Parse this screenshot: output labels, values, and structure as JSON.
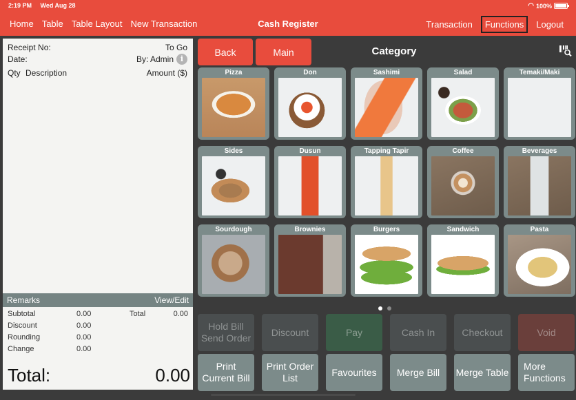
{
  "status_bar": {
    "time": "2:19 PM",
    "date": "Wed Aug 28",
    "battery": "100%",
    "battery_level": 1.0
  },
  "nav": {
    "left": [
      "Home",
      "Table",
      "Table Layout",
      "New Transaction"
    ],
    "title": "Cash Register",
    "right": [
      "Transaction",
      "Functions",
      "Logout"
    ],
    "active": "Functions"
  },
  "receipt": {
    "receipt_no_label": "Receipt No:",
    "order_type": "To Go",
    "date_label": "Date:",
    "by_label": "By: Admin",
    "info_icon": "i",
    "qty_label": "Qty",
    "desc_label": "Description",
    "amount_label": "Amount ($)",
    "remarks_label": "Remarks",
    "view_edit_label": "View/Edit",
    "subtotal_label": "Subtotal",
    "subtotal": "0.00",
    "total_label": "Total",
    "total": "0.00",
    "discount_label": "Discount",
    "discount": "0.00",
    "rounding_label": "Rounding",
    "rounding": "0.00",
    "change_label": "Change",
    "change": "0.00",
    "grand_total_label": "Total:",
    "grand_total": "0.00"
  },
  "category_header": {
    "back": "Back",
    "main": "Main",
    "title": "Category"
  },
  "categories": [
    {
      "name": "Pizza",
      "image": "pizza-photo"
    },
    {
      "name": "Don",
      "image": "don-bowl-photo"
    },
    {
      "name": "Sashimi",
      "image": "sashimi-photo"
    },
    {
      "name": "Salad",
      "image": "salad-photo"
    },
    {
      "name": "Temaki/Maki",
      "image": "temaki-photo"
    },
    {
      "name": "Sides",
      "image": "sides-photo"
    },
    {
      "name": "Dusun",
      "image": "dusun-bottle-photo"
    },
    {
      "name": "Tapping Tapir",
      "image": "tapping-tapir-bottle-photo"
    },
    {
      "name": "Coffee",
      "image": "coffee-photo"
    },
    {
      "name": "Beverages",
      "image": "beverage-photo"
    },
    {
      "name": "Sourdough",
      "image": "sourdough-photo"
    },
    {
      "name": "Brownies",
      "image": "brownies-photo"
    },
    {
      "name": "Burgers",
      "image": "burger-photo"
    },
    {
      "name": "Sandwich",
      "image": "sandwich-photo"
    },
    {
      "name": "Pasta",
      "image": "pasta-photo"
    }
  ],
  "pagination": {
    "current": 1,
    "total": 2
  },
  "functions": {
    "row1": [
      "Hold Bill\nSend Order",
      "Discount",
      "Pay",
      "Cash In",
      "Checkout",
      "Void"
    ],
    "row2": [
      "Print\nCurrent Bill",
      "Print Order\nList",
      "Favourites",
      "Merge Bill",
      "Merge Table",
      "More\nFunctions"
    ]
  },
  "colors": {
    "brand": "#e84c3d",
    "tile": "#7c8b8a",
    "pay": "#3a5c47",
    "void": "#6a3f3b"
  }
}
